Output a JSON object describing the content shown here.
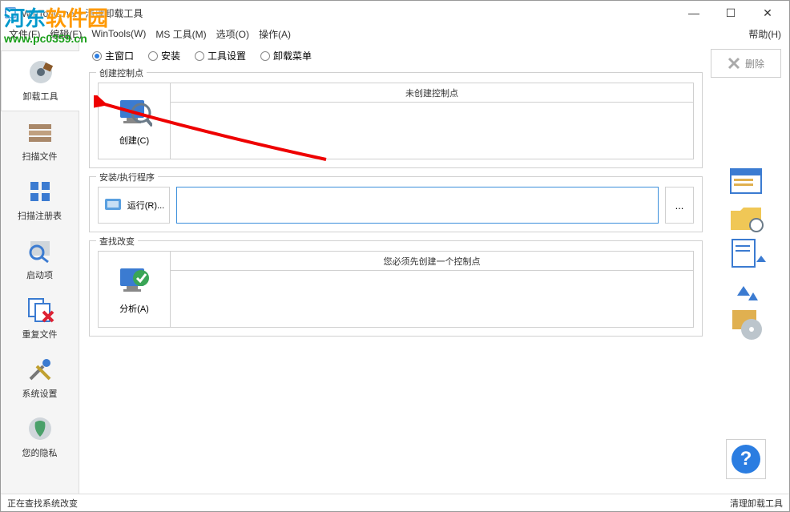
{
  "window": {
    "title": "WinTools.net - 清理卸载工具",
    "min": "—",
    "max": "☐",
    "close": "✕"
  },
  "menu": {
    "file": "文件(F)",
    "edit": "编辑(E)",
    "wintools": "WinTools(W)",
    "mstools": "MS 工具(M)",
    "options": "选项(O)",
    "actions": "操作(A)",
    "help": "帮助(H)"
  },
  "watermark": {
    "brand_a": "河东",
    "brand_b": "软件园",
    "url": "www.pc0359.cn"
  },
  "sidebar": {
    "items": [
      {
        "label": "卸载工具"
      },
      {
        "label": "扫描文件"
      },
      {
        "label": "扫描注册表"
      },
      {
        "label": "启动项"
      },
      {
        "label": "重复文件"
      },
      {
        "label": "系统设置"
      },
      {
        "label": "您的隐私"
      }
    ]
  },
  "tabs": {
    "main": "主窗口",
    "install": "安装",
    "toolset": "工具设置",
    "uninstmenu": "卸载菜单"
  },
  "group1": {
    "legend": "创建控制点",
    "btn": "创建(C)",
    "header": "未创建控制点"
  },
  "group2": {
    "legend": "安装/执行程序",
    "run": "运行(R)...",
    "browse": "...",
    "placeholder": ""
  },
  "group3": {
    "legend": "查找改变",
    "btn": "分析(A)",
    "header": "您必须先创建一个控制点"
  },
  "right": {
    "delete": "删除"
  },
  "status": {
    "left": "正在查找系统改变",
    "right": "清理卸载工具"
  }
}
